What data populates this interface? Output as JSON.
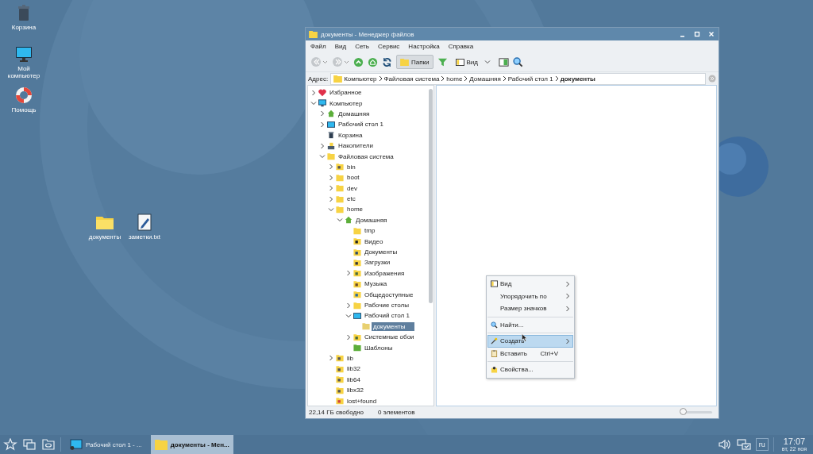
{
  "desktop_icons": [
    {
      "label": "Корзина",
      "kind": "trash"
    },
    {
      "label": "Мой компьютер",
      "kind": "monitor"
    },
    {
      "label": "Помощь",
      "kind": "lifebuoy"
    },
    {
      "label": "документы",
      "kind": "folder"
    },
    {
      "label": "заметки.txt",
      "kind": "textfile"
    }
  ],
  "window": {
    "title": "документы - Менеджер файлов",
    "menu": [
      "Файл",
      "Вид",
      "Сеть",
      "Сервис",
      "Настройка",
      "Справка"
    ],
    "toolbar": [
      {
        "kind": "back",
        "disabled": true
      },
      {
        "kind": "forward",
        "disabled": true
      },
      {
        "kind": "up",
        "disabled": false
      },
      {
        "kind": "home",
        "disabled": false
      },
      {
        "kind": "reload",
        "disabled": false
      },
      {
        "kind": "folders",
        "label": "Папки",
        "selected": true
      },
      {
        "kind": "filter",
        "disabled": false
      },
      {
        "kind": "view",
        "label": "Вид"
      },
      {
        "kind": "panel",
        "disabled": false
      },
      {
        "kind": "search",
        "disabled": false
      }
    ],
    "address": {
      "label": "Адрес:",
      "crumbs": [
        {
          "label": "Компьютер",
          "current": false
        },
        {
          "label": "Файловая система",
          "current": false
        },
        {
          "label": "home",
          "current": false
        },
        {
          "label": "Домашняя",
          "current": false
        },
        {
          "label": "Рабочий стол 1",
          "current": false
        },
        {
          "label": "документы",
          "current": true
        }
      ]
    },
    "tree": [
      {
        "label": "Избранное",
        "kind": "heart",
        "expandable": true,
        "expanded": false,
        "selected": false
      },
      {
        "label": "Компьютер",
        "kind": "monitor",
        "expandable": true,
        "expanded": true,
        "selected": false,
        "children": [
          {
            "label": "Домашняя",
            "kind": "home",
            "expandable": true,
            "expanded": false,
            "selected": false
          },
          {
            "label": "Рабочий стол 1",
            "kind": "desktop",
            "expandable": true,
            "expanded": false,
            "selected": false
          },
          {
            "label": "Корзина",
            "kind": "trash",
            "expandable": false,
            "selected": false
          },
          {
            "label": "Накопители",
            "kind": "drives",
            "expandable": true,
            "expanded": false,
            "selected": false
          },
          {
            "label": "Файловая система",
            "kind": "folder",
            "expandable": true,
            "expanded": true,
            "selected": false,
            "children": [
              {
                "label": "bin",
                "kind": "link",
                "expandable": true,
                "expanded": false,
                "selected": false
              },
              {
                "label": "boot",
                "kind": "folder",
                "expandable": true,
                "expanded": false,
                "selected": false
              },
              {
                "label": "dev",
                "kind": "folder",
                "expandable": true,
                "expanded": false,
                "selected": false
              },
              {
                "label": "etc",
                "kind": "folder",
                "expandable": true,
                "expanded": false,
                "selected": false
              },
              {
                "label": "home",
                "kind": "folder",
                "expandable": true,
                "expanded": true,
                "selected": false,
                "children": [
                  {
                    "label": "Домашняя",
                    "kind": "home",
                    "expandable": true,
                    "expanded": true,
                    "selected": false,
                    "children": [
                      {
                        "label": "tmp",
                        "kind": "folder",
                        "expandable": false,
                        "selected": false
                      },
                      {
                        "label": "Видео",
                        "kind": "video",
                        "expandable": false,
                        "selected": false
                      },
                      {
                        "label": "Документы",
                        "kind": "docs",
                        "expandable": false,
                        "selected": false
                      },
                      {
                        "label": "Загрузки",
                        "kind": "download",
                        "expandable": false,
                        "selected": false
                      },
                      {
                        "label": "Изображения",
                        "kind": "images",
                        "expandable": true,
                        "expanded": false,
                        "selected": false
                      },
                      {
                        "label": "Музыка",
                        "kind": "music",
                        "expandable": false,
                        "selected": false
                      },
                      {
                        "label": "Общедоступные",
                        "kind": "public",
                        "expandable": false,
                        "selected": false
                      },
                      {
                        "label": "Рабочие столы",
                        "kind": "folder",
                        "expandable": true,
                        "expanded": false,
                        "selected": false
                      },
                      {
                        "label": "Рабочий стол 1",
                        "kind": "desktop",
                        "expandable": true,
                        "expanded": true,
                        "selected": false,
                        "children": [
                          {
                            "label": "документы",
                            "kind": "folder",
                            "expandable": false,
                            "selected": true
                          }
                        ]
                      },
                      {
                        "label": "Системные обои",
                        "kind": "images",
                        "expandable": true,
                        "expanded": false,
                        "selected": false
                      },
                      {
                        "label": "Шаблоны",
                        "kind": "templates",
                        "expandable": false,
                        "selected": false
                      }
                    ]
                  }
                ]
              },
              {
                "label": "lib",
                "kind": "link",
                "expandable": true,
                "expanded": false,
                "selected": false
              },
              {
                "label": "lib32",
                "kind": "link",
                "expandable": false,
                "selected": false
              },
              {
                "label": "lib64",
                "kind": "link",
                "expandable": false,
                "selected": false
              },
              {
                "label": "libx32",
                "kind": "link",
                "expandable": false,
                "selected": false
              },
              {
                "label": "lost+found",
                "kind": "locked",
                "expandable": false,
                "selected": false
              }
            ]
          }
        ]
      }
    ],
    "status": {
      "free": "22,14 ГБ свободно",
      "count": "0 элементов",
      "zoom": {
        "level": 0.05
      }
    }
  },
  "context_menu": [
    {
      "kind": "view",
      "label": "Вид",
      "submenu": true,
      "selected": false
    },
    {
      "kind": "plain",
      "label": "Упорядочить по",
      "submenu": true,
      "selected": false
    },
    {
      "kind": "plain",
      "label": "Размер значков",
      "submenu": true,
      "selected": false
    },
    {
      "kind": "separator"
    },
    {
      "kind": "search",
      "label": "Найти...",
      "submenu": false,
      "selected": false
    },
    {
      "kind": "separator"
    },
    {
      "kind": "create",
      "label": "Создать",
      "submenu": true,
      "selected": true
    },
    {
      "kind": "paste",
      "label": "Вставить",
      "shortcut": "Ctrl+V",
      "submenu": false,
      "selected": false
    },
    {
      "kind": "separator"
    },
    {
      "kind": "properties",
      "label": "Свойства...",
      "submenu": false,
      "selected": false
    }
  ],
  "taskbar": {
    "tasks": [
      {
        "label": "Рабочий стол 1 - ...",
        "kind": "desktop",
        "selected": false
      },
      {
        "label": "документы - Мен...",
        "kind": "folder",
        "selected": true
      }
    ],
    "language": "ru",
    "time": "17:07",
    "date": "вт, 22 ноя"
  }
}
